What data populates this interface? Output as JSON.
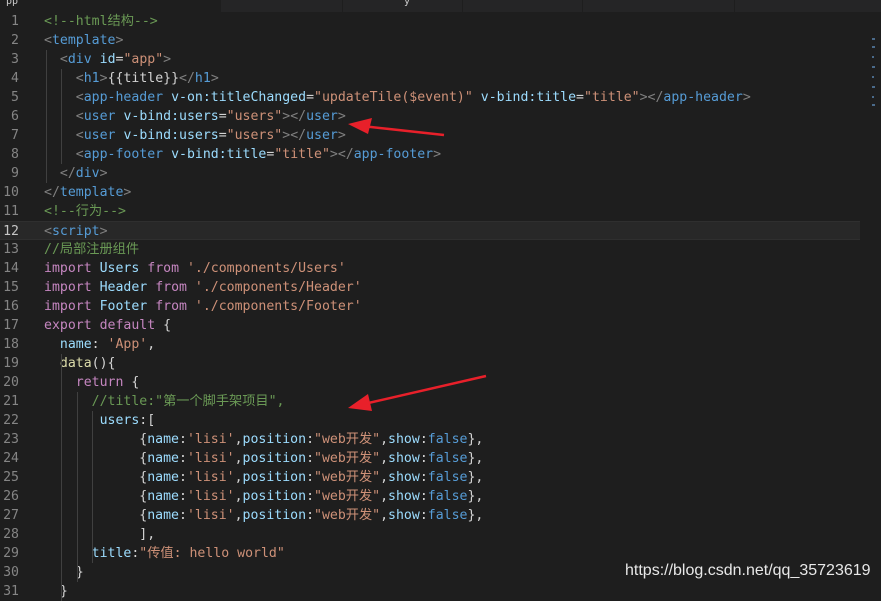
{
  "tabs": [
    {
      "label": "pp",
      "active": true
    },
    {
      "label": "",
      "active": false
    },
    {
      "label": "y",
      "active": false
    },
    {
      "label": "",
      "active": false
    },
    {
      "label": "",
      "active": false
    }
  ],
  "current_line": 12,
  "lines": [
    {
      "n": "1",
      "segs": [
        [
          "com",
          "<!--html结构-->"
        ]
      ]
    },
    {
      "n": "2",
      "segs": [
        [
          "br",
          "<"
        ],
        [
          "tag",
          "template"
        ],
        [
          "br",
          ">"
        ]
      ]
    },
    {
      "n": "3",
      "segs": [
        [
          "txt",
          "  "
        ],
        [
          "br",
          "<"
        ],
        [
          "tag",
          "div"
        ],
        [
          "txt",
          " "
        ],
        [
          "attr",
          "id"
        ],
        [
          "txt",
          "="
        ],
        [
          "str",
          "\"app\""
        ],
        [
          "br",
          ">"
        ]
      ]
    },
    {
      "n": "4",
      "segs": [
        [
          "txt",
          "    "
        ],
        [
          "br",
          "<"
        ],
        [
          "tag",
          "h1"
        ],
        [
          "br",
          ">"
        ],
        [
          "txt",
          "{{title}}"
        ],
        [
          "br",
          "</"
        ],
        [
          "tag",
          "h1"
        ],
        [
          "br",
          ">"
        ]
      ]
    },
    {
      "n": "5",
      "segs": [
        [
          "txt",
          "    "
        ],
        [
          "br",
          "<"
        ],
        [
          "tag",
          "app-header"
        ],
        [
          "txt",
          " "
        ],
        [
          "attr",
          "v-on:titleChanged"
        ],
        [
          "txt",
          "="
        ],
        [
          "str",
          "\"updateTile($event)\""
        ],
        [
          "txt",
          " "
        ],
        [
          "attr",
          "v-bind:title"
        ],
        [
          "txt",
          "="
        ],
        [
          "str",
          "\"title\""
        ],
        [
          "br",
          "></"
        ],
        [
          "tag",
          "app-header"
        ],
        [
          "br",
          ">"
        ]
      ]
    },
    {
      "n": "6",
      "segs": [
        [
          "txt",
          "    "
        ],
        [
          "br",
          "<"
        ],
        [
          "tag",
          "user"
        ],
        [
          "txt",
          " "
        ],
        [
          "attr",
          "v-bind:users"
        ],
        [
          "txt",
          "="
        ],
        [
          "str",
          "\"users\""
        ],
        [
          "br",
          "></"
        ],
        [
          "tag",
          "user"
        ],
        [
          "br",
          ">"
        ]
      ]
    },
    {
      "n": "7",
      "segs": [
        [
          "txt",
          "    "
        ],
        [
          "br",
          "<"
        ],
        [
          "tag",
          "user"
        ],
        [
          "txt",
          " "
        ],
        [
          "attr",
          "v-bind:users"
        ],
        [
          "txt",
          "="
        ],
        [
          "str",
          "\"users\""
        ],
        [
          "br",
          "></"
        ],
        [
          "tag",
          "user"
        ],
        [
          "br",
          ">"
        ]
      ]
    },
    {
      "n": "8",
      "segs": [
        [
          "txt",
          "    "
        ],
        [
          "br",
          "<"
        ],
        [
          "tag",
          "app-footer"
        ],
        [
          "txt",
          " "
        ],
        [
          "attr",
          "v-bind:title"
        ],
        [
          "txt",
          "="
        ],
        [
          "str",
          "\"title\""
        ],
        [
          "br",
          "></"
        ],
        [
          "tag",
          "app-footer"
        ],
        [
          "br",
          ">"
        ]
      ]
    },
    {
      "n": "9",
      "segs": [
        [
          "txt",
          "  "
        ],
        [
          "br",
          "</"
        ],
        [
          "tag",
          "div"
        ],
        [
          "br",
          ">"
        ]
      ]
    },
    {
      "n": "10",
      "segs": [
        [
          "br",
          "</"
        ],
        [
          "tag",
          "template"
        ],
        [
          "br",
          ">"
        ]
      ]
    },
    {
      "n": "11",
      "segs": [
        [
          "com",
          "<!--行为-->"
        ]
      ]
    },
    {
      "n": "12",
      "segs": [
        [
          "br",
          "<"
        ],
        [
          "tag",
          "script"
        ],
        [
          "br",
          ">"
        ]
      ]
    },
    {
      "n": "13",
      "segs": [
        [
          "com",
          "//局部注册组件"
        ]
      ]
    },
    {
      "n": "14",
      "segs": [
        [
          "kw",
          "import"
        ],
        [
          "txt",
          " "
        ],
        [
          "var",
          "Users"
        ],
        [
          "txt",
          " "
        ],
        [
          "kw",
          "from"
        ],
        [
          "txt",
          " "
        ],
        [
          "str",
          "'./components/Users'"
        ]
      ]
    },
    {
      "n": "15",
      "segs": [
        [
          "kw",
          "import"
        ],
        [
          "txt",
          " "
        ],
        [
          "var",
          "Header"
        ],
        [
          "txt",
          " "
        ],
        [
          "kw",
          "from"
        ],
        [
          "txt",
          " "
        ],
        [
          "str",
          "'./components/Header'"
        ]
      ]
    },
    {
      "n": "16",
      "segs": [
        [
          "kw",
          "import"
        ],
        [
          "txt",
          " "
        ],
        [
          "var",
          "Footer"
        ],
        [
          "txt",
          " "
        ],
        [
          "kw",
          "from"
        ],
        [
          "txt",
          " "
        ],
        [
          "str",
          "'./components/Footer'"
        ]
      ]
    },
    {
      "n": "17",
      "segs": [
        [
          "kw",
          "export"
        ],
        [
          "txt",
          " "
        ],
        [
          "kw",
          "default"
        ],
        [
          "txt",
          " {"
        ]
      ]
    },
    {
      "n": "18",
      "segs": [
        [
          "txt",
          "  "
        ],
        [
          "var",
          "name"
        ],
        [
          "txt",
          ": "
        ],
        [
          "str",
          "'App'"
        ],
        [
          "txt",
          ","
        ]
      ]
    },
    {
      "n": "19",
      "segs": [
        [
          "txt",
          "  "
        ],
        [
          "fn",
          "data"
        ],
        [
          "txt",
          "(){"
        ]
      ]
    },
    {
      "n": "20",
      "segs": [
        [
          "txt",
          "    "
        ],
        [
          "kw",
          "return"
        ],
        [
          "txt",
          " {"
        ]
      ]
    },
    {
      "n": "21",
      "segs": [
        [
          "txt",
          "      "
        ],
        [
          "com",
          "//title:\"第一个脚手架项目\","
        ]
      ]
    },
    {
      "n": "22",
      "segs": [
        [
          "txt",
          "       "
        ],
        [
          "var",
          "users"
        ],
        [
          "txt",
          ":["
        ]
      ]
    },
    {
      "n": "23",
      "segs": [
        [
          "txt",
          "            {"
        ],
        [
          "var",
          "name"
        ],
        [
          "txt",
          ":"
        ],
        [
          "str",
          "'lisi'"
        ],
        [
          "txt",
          ","
        ],
        [
          "var",
          "position"
        ],
        [
          "txt",
          ":"
        ],
        [
          "str",
          "\"web开发\""
        ],
        [
          "txt",
          ","
        ],
        [
          "var",
          "show"
        ],
        [
          "txt",
          ":"
        ],
        [
          "bool",
          "false"
        ],
        [
          "txt",
          "},"
        ]
      ]
    },
    {
      "n": "24",
      "segs": [
        [
          "txt",
          "            {"
        ],
        [
          "var",
          "name"
        ],
        [
          "txt",
          ":"
        ],
        [
          "str",
          "'lisi'"
        ],
        [
          "txt",
          ","
        ],
        [
          "var",
          "position"
        ],
        [
          "txt",
          ":"
        ],
        [
          "str",
          "\"web开发\""
        ],
        [
          "txt",
          ","
        ],
        [
          "var",
          "show"
        ],
        [
          "txt",
          ":"
        ],
        [
          "bool",
          "false"
        ],
        [
          "txt",
          "},"
        ]
      ]
    },
    {
      "n": "25",
      "segs": [
        [
          "txt",
          "            {"
        ],
        [
          "var",
          "name"
        ],
        [
          "txt",
          ":"
        ],
        [
          "str",
          "'lisi'"
        ],
        [
          "txt",
          ","
        ],
        [
          "var",
          "position"
        ],
        [
          "txt",
          ":"
        ],
        [
          "str",
          "\"web开发\""
        ],
        [
          "txt",
          ","
        ],
        [
          "var",
          "show"
        ],
        [
          "txt",
          ":"
        ],
        [
          "bool",
          "false"
        ],
        [
          "txt",
          "},"
        ]
      ]
    },
    {
      "n": "26",
      "segs": [
        [
          "txt",
          "            {"
        ],
        [
          "var",
          "name"
        ],
        [
          "txt",
          ":"
        ],
        [
          "str",
          "'lisi'"
        ],
        [
          "txt",
          ","
        ],
        [
          "var",
          "position"
        ],
        [
          "txt",
          ":"
        ],
        [
          "str",
          "\"web开发\""
        ],
        [
          "txt",
          ","
        ],
        [
          "var",
          "show"
        ],
        [
          "txt",
          ":"
        ],
        [
          "bool",
          "false"
        ],
        [
          "txt",
          "},"
        ]
      ]
    },
    {
      "n": "27",
      "segs": [
        [
          "txt",
          "            {"
        ],
        [
          "var",
          "name"
        ],
        [
          "txt",
          ":"
        ],
        [
          "str",
          "'lisi'"
        ],
        [
          "txt",
          ","
        ],
        [
          "var",
          "position"
        ],
        [
          "txt",
          ":"
        ],
        [
          "str",
          "\"web开发\""
        ],
        [
          "txt",
          ","
        ],
        [
          "var",
          "show"
        ],
        [
          "txt",
          ":"
        ],
        [
          "bool",
          "false"
        ],
        [
          "txt",
          "},"
        ]
      ]
    },
    {
      "n": "28",
      "segs": [
        [
          "txt",
          "            ],"
        ]
      ]
    },
    {
      "n": "29",
      "segs": [
        [
          "txt",
          "      "
        ],
        [
          "var",
          "title"
        ],
        [
          "txt",
          ":"
        ],
        [
          "str",
          "\"传值: hello world\""
        ]
      ]
    },
    {
      "n": "30",
      "segs": [
        [
          "txt",
          "    }"
        ]
      ]
    },
    {
      "n": "31",
      "segs": [
        [
          "txt",
          "  }"
        ]
      ]
    }
  ],
  "watermark": "https://blog.csdn.net/qq_35723619"
}
